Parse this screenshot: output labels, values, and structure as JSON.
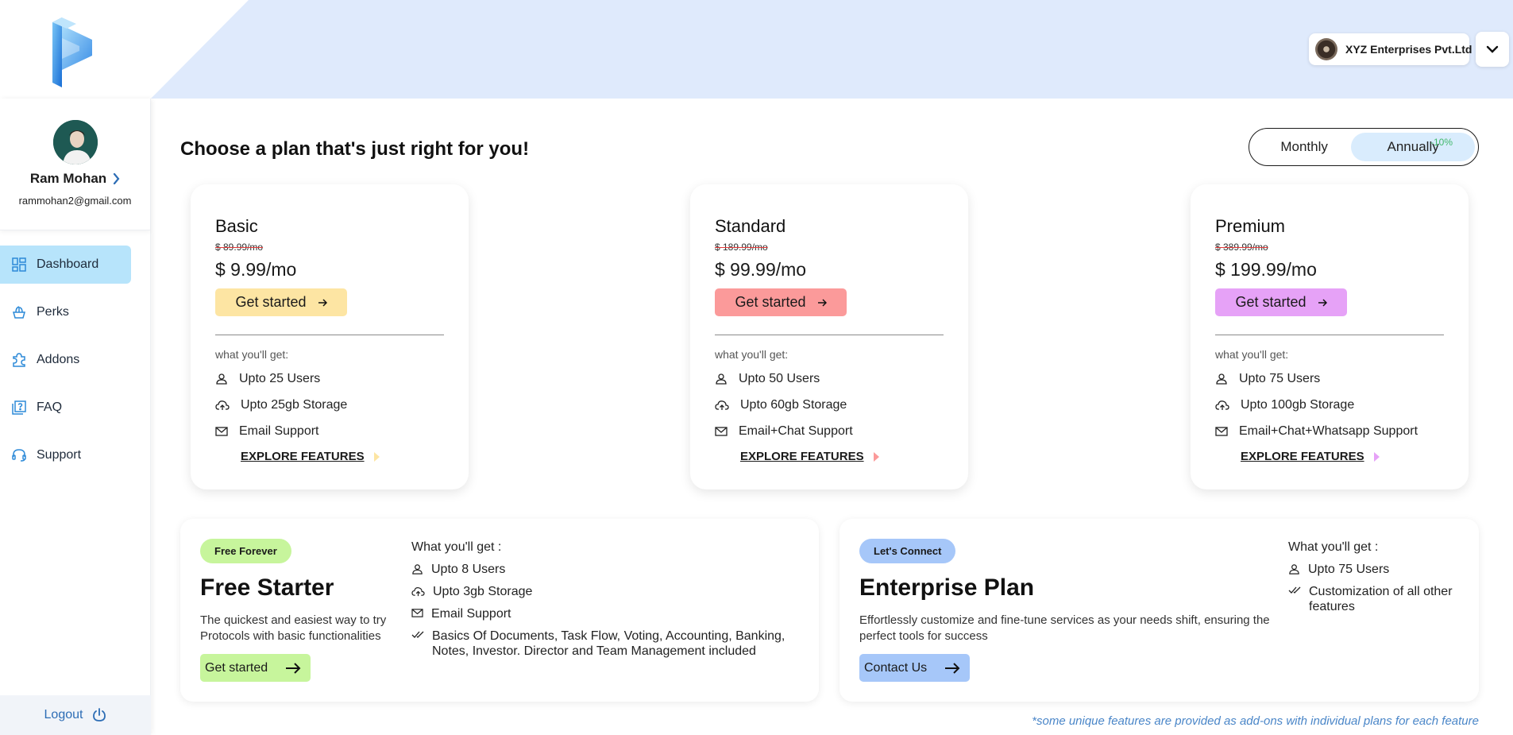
{
  "company": {
    "name": "XYZ Enterprises Pvt.Ltd"
  },
  "user": {
    "name": "Ram Mohan",
    "email": "rammohan2@gmail.com"
  },
  "nav": [
    {
      "label": "Dashboard",
      "icon": "dashboard-icon",
      "active": true
    },
    {
      "label": "Perks",
      "icon": "perks-icon",
      "active": false
    },
    {
      "label": "Addons",
      "icon": "puzzle-icon",
      "active": false
    },
    {
      "label": "FAQ",
      "icon": "faq-icon",
      "active": false
    },
    {
      "label": "Support",
      "icon": "headset-icon",
      "active": false
    }
  ],
  "logout_label": "Logout",
  "page": {
    "heading": "Choose a plan that's just right for you!",
    "billing": {
      "monthly": "Monthly",
      "annually": "Annually",
      "discount": "-10%",
      "selected": "Annually"
    }
  },
  "plans": [
    {
      "name": "Basic",
      "old_price": "$ 89.99/mo",
      "price": "$ 9.99/mo",
      "button": "Get started",
      "accent": "#fde5a3",
      "whats_included": "what you'll get:",
      "features": [
        "Upto 25 Users",
        "Upto 25gb Storage",
        "Email Support"
      ],
      "explore": "EXPLORE FEATURES"
    },
    {
      "name": "Standard",
      "old_price": "$ 189.99/mo",
      "price": "$ 99.99/mo",
      "button": "Get started",
      "accent": "#fb9a9a",
      "whats_included": "what you'll get:",
      "features": [
        "Upto 50 Users",
        "Upto 60gb Storage",
        "Email+Chat Support"
      ],
      "explore": "EXPLORE FEATURES"
    },
    {
      "name": "Premium",
      "old_price": "$ 389.99/mo",
      "price": "$ 199.99/mo",
      "button": "Get started",
      "accent": "#e6a2f7",
      "whats_included": "what you'll get:",
      "features": [
        "Upto 75 Users",
        "Upto 100gb Storage",
        "Email+Chat+Whatsapp Support"
      ],
      "explore": "EXPLORE FEATURES"
    }
  ],
  "free_plan": {
    "badge": "Free Forever",
    "badge_color": "#c7f59c",
    "title": "Free Starter",
    "description": "The quickest and easiest way to try Protocols with basic functionalities",
    "button": "Get started",
    "button_color": "#c7f59c",
    "list_title": "What you'll get :",
    "features": [
      "Upto 8 Users",
      "Upto 3gb Storage",
      "Email Support",
      "Basics Of Documents, Task Flow, Voting, Accounting, Banking, Notes, Investor. Director and Team Management included"
    ]
  },
  "enterprise_plan": {
    "badge": "Let's Connect",
    "badge_color": "#a6c7f9",
    "title": "Enterprise Plan",
    "description": "Effortlessly customize and fine-tune services as your needs shift, ensuring the perfect tools for success",
    "button": "Contact Us",
    "button_color": "#a6c7f9",
    "list_title": "What you'll get :",
    "features": [
      "Upto 75 Users",
      "Customization of all other features"
    ]
  },
  "footnote": "*some unique features are provided as add-ons with individual plans for each feature"
}
